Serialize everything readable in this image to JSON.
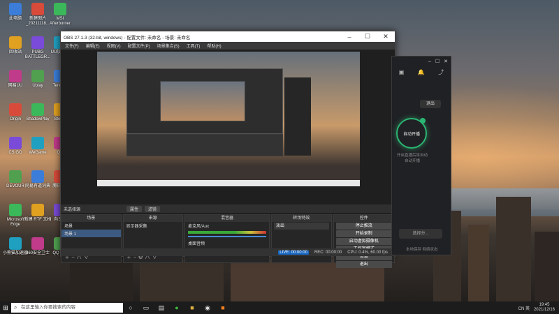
{
  "desktop_icons": [
    {
      "label": "此电脑"
    },
    {
      "label": "新建图片_20211118..."
    },
    {
      "label": "MSI Afterburner"
    },
    {
      "label": "回收站"
    },
    {
      "label": "PUBG BATTLEGR..."
    },
    {
      "label": "UU加速器"
    },
    {
      "label": "网易UU"
    },
    {
      "label": "Uplay"
    },
    {
      "label": "Tencent"
    },
    {
      "label": "Origin"
    },
    {
      "label": "ShadowPlay"
    },
    {
      "label": "Steam"
    },
    {
      "label": "CS:GO"
    },
    {
      "label": "WeGame"
    },
    {
      "label": "QQ"
    },
    {
      "label": "DEVOUR"
    },
    {
      "label": "网易有道词典"
    },
    {
      "label": "腾讯QQ"
    },
    {
      "label": "Microsoft Edge"
    },
    {
      "label": "新建 RTF 文档"
    },
    {
      "label": "向日葵"
    },
    {
      "label": "小熊猫加速器"
    },
    {
      "label": "360安全卫士"
    },
    {
      "label": "QQ飞车"
    }
  ],
  "obs": {
    "title": "OBS 27.1.3 (32-bit, windows) - 配置文件: 未命名 - 场景: 未命名",
    "menu": [
      "文件(F)",
      "编辑(E)",
      "视图(V)",
      "配置文件(P)",
      "场景集合(S)",
      "工具(T)",
      "帮助(H)"
    ],
    "source_label": "未选择源",
    "prop_btn": "属性",
    "filter_btn": "滤镜",
    "dock_scenes": "场景",
    "dock_sources": "来源",
    "dock_mixer": "混音器",
    "dock_transitions": "转场特效",
    "dock_controls": "控件",
    "scene_items": [
      "场景",
      "场景 1"
    ],
    "source_items": [
      "显示器采集"
    ],
    "mixer": [
      {
        "name": "麦克风/Aux",
        "db": "0.0 dB"
      },
      {
        "name": "桌面音频",
        "db": "0.0 dB"
      }
    ],
    "transition": "淡出",
    "controls": [
      "停止推流",
      "开始录制",
      "启动虚拟摄像机",
      "工作室模式",
      "设置",
      "退出"
    ],
    "status": {
      "live": "LIVE: 00:00:00",
      "rec": "REC: 00:00:00",
      "cpu": "CPU: 0.4%, 60.00 fps"
    }
  },
  "app2": {
    "exit": "退出",
    "circle_label": "自动开播",
    "sub": "开启直播后将自动 自动开播",
    "bottom": "选择分...",
    "foot": "本地保存  网络状态"
  },
  "taskbar": {
    "search_placeholder": "在这里输入你要搜索的内容",
    "clock_time": "19:45",
    "clock_date": "2021/12/16",
    "tray_text": "CN  英"
  }
}
